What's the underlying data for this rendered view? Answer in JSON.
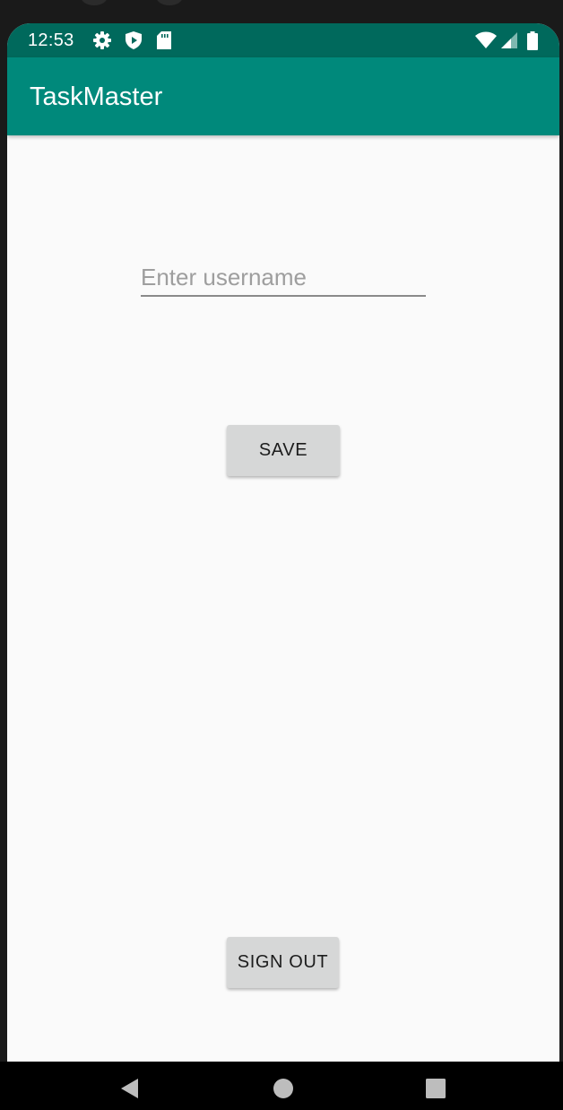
{
  "status_bar": {
    "time": "12:53",
    "icons": [
      "gear-icon",
      "play-protect-icon",
      "sd-card-icon",
      "wifi-icon",
      "signal-icon",
      "battery-icon"
    ]
  },
  "app_bar": {
    "title": "TaskMaster"
  },
  "username_input": {
    "value": "",
    "placeholder": "Enter username"
  },
  "save_button": {
    "label": "SAVE"
  },
  "sign_out_button": {
    "label": "SIGN OUT"
  },
  "nav_bar": {
    "icons": [
      "back-icon",
      "home-icon",
      "recents-icon"
    ]
  },
  "colors": {
    "status_bar": "#00695c",
    "app_bar": "#00897b",
    "background": "#fafafa",
    "button": "#d6d7d7"
  }
}
